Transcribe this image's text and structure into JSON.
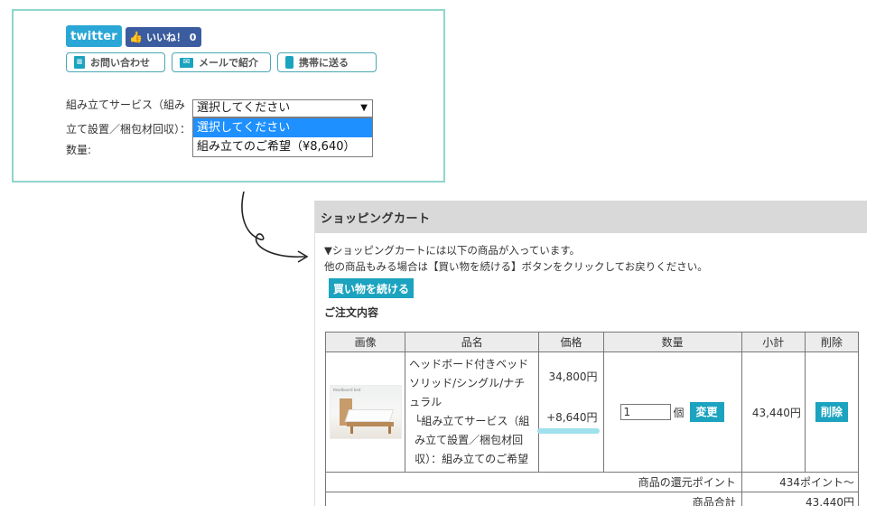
{
  "product": {
    "social": {
      "twitter_label": "twitter",
      "like_label": "いいね！ 0"
    },
    "actions": [
      {
        "label": "お問い合わせ",
        "icon": "document-icon"
      },
      {
        "label": "メールで紹介",
        "icon": "mail-icon"
      },
      {
        "label": "携帯に送る",
        "icon": "mobile-icon"
      }
    ],
    "assembly_label": "組み立てサービス（組み立て設置／梱包材回収）：",
    "quantity_label": "数量:",
    "select": {
      "value": "選択してください",
      "options": [
        "選択してください",
        "組み立てのご希望（¥8,640）"
      ]
    }
  },
  "cart": {
    "title": "ショッピングカート",
    "intro_line1": "▼ショッピングカートには以下の商品が入っています。",
    "intro_line2": "他の商品もみる場合は【買い物を続ける】ボタンをクリックしてお戻りください。",
    "continue_label": "買い物を続ける",
    "order_title": "ご注文内容",
    "columns": [
      "画像",
      "品名",
      "価格",
      "数量",
      "小計",
      "削除"
    ],
    "item": {
      "image_caption": "Headboard bed",
      "name": "ヘッドボード付きベッド　ソリッド/シングル/ナチュラル",
      "option_name": "└組み立てサービス（組み立て設置／梱包材回収）：組み立てのご希望",
      "price": "34,800円",
      "option_price": "+8,640円",
      "quantity": "1",
      "unit": "個",
      "change_label": "変更",
      "subtotal": "43,440円",
      "delete_label": "削除"
    },
    "points_label": "商品の還元ポイント",
    "points_value": "434ポイント～",
    "total_label": "商品合計",
    "total_value": "43,440円"
  }
}
